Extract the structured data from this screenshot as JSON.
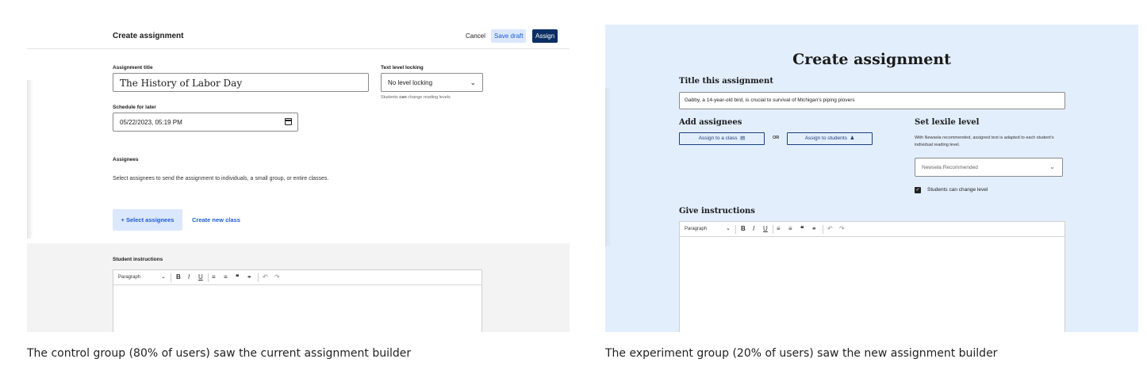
{
  "control": {
    "header": {
      "title": "Create assignment",
      "cancel": "Cancel",
      "save_draft": "Save draft",
      "assign": "Assign"
    },
    "title_label": "Assignment title",
    "title_value": "The History of Labor Day",
    "level_label": "Text level locking",
    "level_value": "No level locking",
    "level_helper_pre": "Students ",
    "level_helper_bold": "can",
    "level_helper_post": " change reading levels",
    "schedule_label": "Schedule for later",
    "schedule_value": "05/22/2023, 05:19 PM",
    "assignees_label": "Assignees",
    "assignees_desc": "Select assignees to send the assignment to individuals, a small group, or entire classes.",
    "select_assignees": "+ Select assignees",
    "create_class": "Create new class",
    "instructions_label": "Student instructions",
    "toolbar_paragraph": "Paragraph"
  },
  "experiment": {
    "title": "Create assignment",
    "title_section": "Title this assignment",
    "title_value": "Gabby, a 14-year-old bird, is crucial to survival of Michigan's piping plovers",
    "assignees_heading": "Add assignees",
    "assign_class": "Assign to a class",
    "or": "OR",
    "assign_students": "Assign to students",
    "lexile_heading": "Set lexile level",
    "lexile_desc": "With Newsela recommended, assigned text is adapted to each student's individual reading level.",
    "lexile_value": "Newsela Recommended",
    "change_level": "Students can change level",
    "instructions_heading": "Give instructions",
    "toolbar_paragraph": "Paragraph"
  },
  "captions": {
    "control": "The control group (80% of users) saw the current assignment builder",
    "experiment": "The experiment group (20% of users) saw the new assignment builder"
  },
  "icons": {
    "dropdown": "chevron-down-icon",
    "calendar": "calendar-icon",
    "class": "class-icon",
    "student": "person-icon",
    "checkbox": "checkbox-checked-icon"
  },
  "colors": {
    "primary_blue": "#1e5bd2",
    "navy": "#0c2f63",
    "light_blue_bg": "#e3eefd",
    "button_tint": "#dbe7fb"
  }
}
